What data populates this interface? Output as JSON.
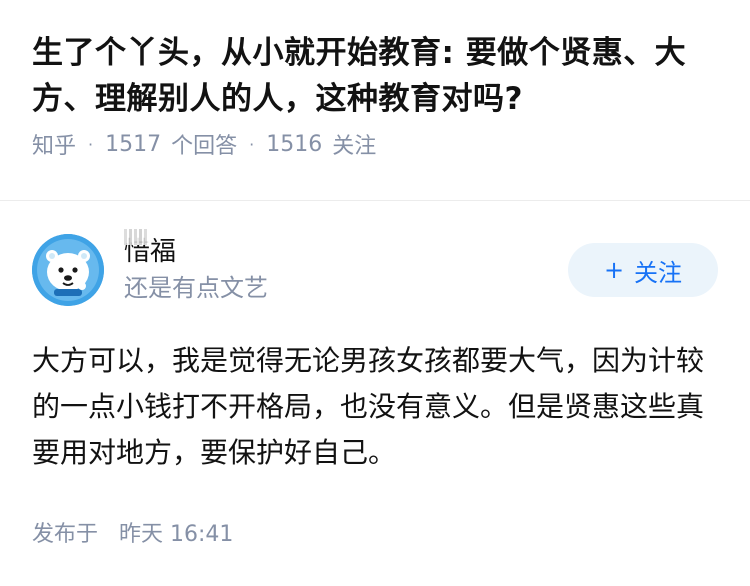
{
  "question": {
    "title": "生了个丫头，从小就开始教育: 要做个贤惠、大方、理解别人的人，这种教育对吗?",
    "source": "知乎",
    "answer_count": "1517",
    "answer_label": "个回答",
    "follow_count": "1516",
    "follow_label": "关注"
  },
  "answer": {
    "author_name": "惜福",
    "author_bio": "还是有点文艺",
    "follow_button": "关注",
    "follow_plus": "+",
    "content": "大方可以，我是觉得无论男孩女孩都要大气，因为计较的一点小钱打不开格局，也没有意义。但是贤惠这些真要用对地方，要保护好自己。",
    "time_label": "发布于",
    "time_value": "昨天 16:41"
  },
  "colors": {
    "text_primary": "#121212",
    "text_secondary": "#8590a6",
    "accent": "#1772f6",
    "follow_bg": "#ebf4fb",
    "avatar_bg": "#3fa3e6"
  }
}
